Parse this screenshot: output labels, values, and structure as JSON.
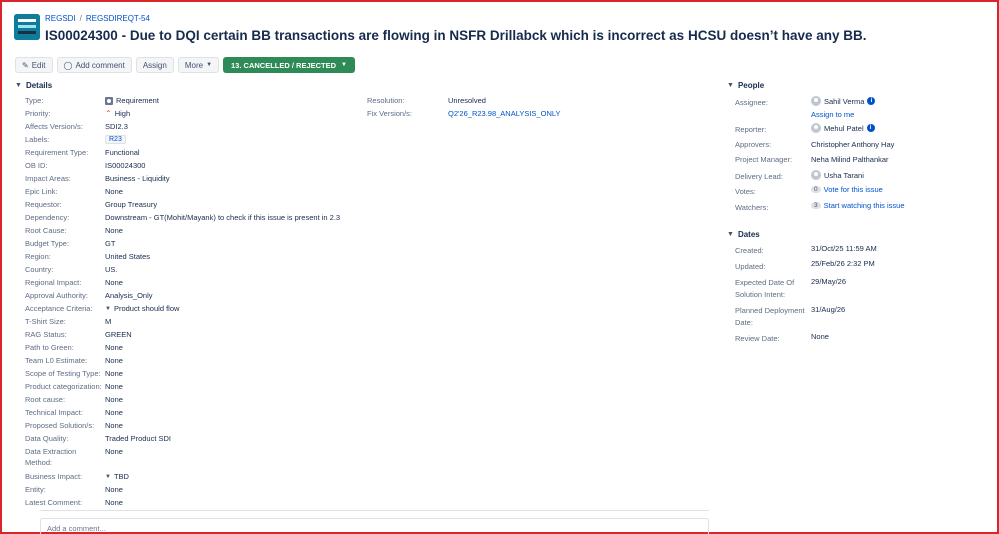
{
  "breadcrumb": {
    "project": "REGSDI",
    "separator": "/",
    "issue_key": "REGSDIREQT-54"
  },
  "issue": {
    "title": "IS00024300 - Due to DQI certain BB transactions are flowing in NSFR Drillabck which is incorrect as HCSU doesn’t have any BB."
  },
  "toolbar": {
    "edit_label": "Edit",
    "add_comment_label": "Add comment",
    "assign_label": "Assign",
    "more_label": "More",
    "status_label": "13. CANCELLED / REJECTED",
    "status_color": "#2e8b57"
  },
  "details": {
    "heading": "Details",
    "left_fields": [
      {
        "label": "Type:",
        "value": "Requirement"
      },
      {
        "label": "Priority:",
        "value": "High"
      },
      {
        "label": "Affects Version/s:",
        "value": "SDI2.3"
      },
      {
        "label": "Labels:",
        "value": "R23"
      },
      {
        "label": "Requirement Type:",
        "value": "Functional"
      },
      {
        "label": "OB ID:",
        "value": "IS00024300"
      },
      {
        "label": "Impact Areas:",
        "value": "Business - Liquidity"
      },
      {
        "label": "Epic Link:",
        "value": "None"
      },
      {
        "label": "Requestor:",
        "value": "Group Treasury"
      },
      {
        "label": "Dependency:",
        "value": "Downstream - GT(Mohit/Mayank) to check if this issue is present in 2.3"
      },
      {
        "label": "Root Cause:",
        "value": "None"
      },
      {
        "label": "Budget Type:",
        "value": "GT"
      },
      {
        "label": "Region:",
        "value": "United States"
      },
      {
        "label": "Country:",
        "value": "US."
      },
      {
        "label": "Regional Impact:",
        "value": "None"
      },
      {
        "label": "Approval Authority:",
        "value": "Analysis_Only"
      },
      {
        "label": "Acceptance Criteria:",
        "value": "Product should flow"
      },
      {
        "label": "T-Shirt Size:",
        "value": "M"
      },
      {
        "label": "RAG Status:",
        "value": "GREEN"
      },
      {
        "label": "Path to Green:",
        "value": "None"
      },
      {
        "label": "Team L0 Estimate:",
        "value": "None"
      },
      {
        "label": "Scope of Testing Type:",
        "value": "None"
      },
      {
        "label": "Product categorization:",
        "value": "None"
      },
      {
        "label": "Root cause:",
        "value": "None"
      },
      {
        "label": "Technical Impact:",
        "value": "None"
      },
      {
        "label": "Proposed Solution/s:",
        "value": "None"
      },
      {
        "label": "Data Quality:",
        "value": "Traded Product SDI"
      },
      {
        "label": "Data Extraction",
        "label2": "Method:",
        "value": "None"
      },
      {
        "label": "Business Impact:",
        "value": "TBD"
      },
      {
        "label": "Entity:",
        "value": "None"
      },
      {
        "label": "Latest Comment:",
        "value": "None"
      }
    ],
    "right_fields": [
      {
        "label": "Resolution:",
        "value": "Unresolved"
      },
      {
        "label": "Fix Version/s:",
        "value": "Q2'26_R23.98_ANALYSIS_ONLY"
      }
    ]
  },
  "people": {
    "heading": "People",
    "assignee_label": "Assignee:",
    "assignee": "Sahil Verma",
    "assign_to_me": "Assign to me",
    "reporter_label": "Reporter:",
    "reporter": "Mehul Patel",
    "approvers_label": "Approvers:",
    "approvers": "Christopher Anthony Hay",
    "pm_label": "Project Manager:",
    "pm": "Neha Milind Palthankar",
    "delivery_label": "Delivery Lead:",
    "delivery": "Usha Tarani",
    "votes_label": "Votes:",
    "votes_count": "0",
    "votes_link": "Vote for this issue",
    "watchers_label": "Watchers:",
    "watchers_count": "3",
    "watchers_link": "Start watching this issue"
  },
  "dates": {
    "heading": "Dates",
    "created_label": "Created:",
    "created": "31/Oct/25 11:59 AM",
    "updated_label": "Updated:",
    "updated": "25/Feb/26 2:32 PM",
    "expected_label1": "Expected Date Of",
    "expected_label2": "Solution Intent:",
    "expected": "29/May/26",
    "planned_label1": "Planned Deployment",
    "planned_label2": "Date:",
    "planned": "31/Aug/26",
    "review_label": "Review Date:",
    "review": "None"
  },
  "comment": {
    "placeholder": "Add a comment..."
  }
}
